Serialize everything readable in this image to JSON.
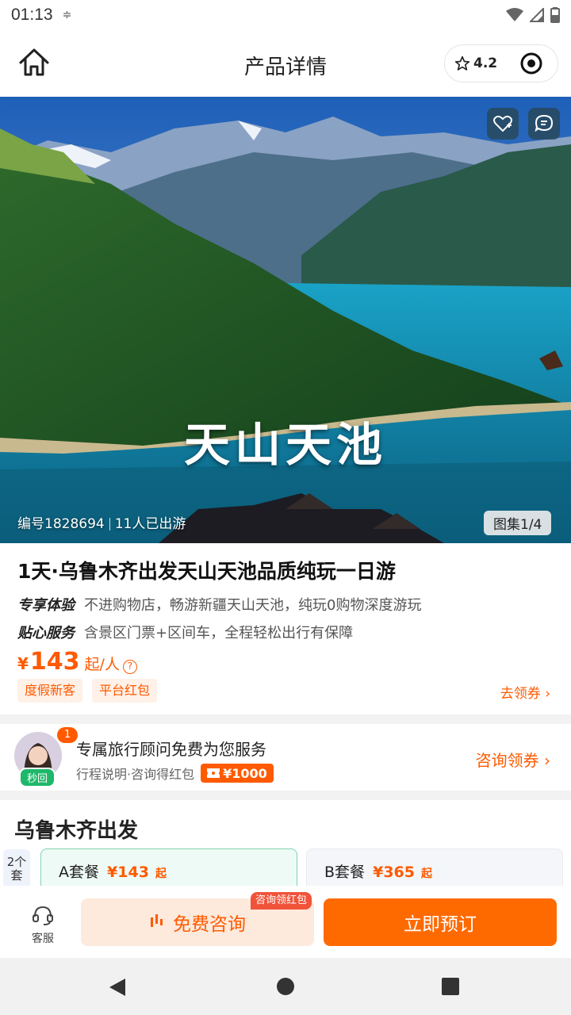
{
  "status_bar": {
    "time": "01:13"
  },
  "header": {
    "title": "产品详情",
    "rating": "4.2"
  },
  "hero": {
    "overlay_title": "天山天池",
    "code": "编号1828694",
    "visited": "11人已出游",
    "gallery": "图集1/4"
  },
  "product": {
    "title": "1天·乌鲁木齐出发天山天池品质纯玩一日游",
    "features": [
      {
        "tag": "专享体验",
        "desc": "不进购物店，畅游新疆天山天池，纯玩0购物深度游玩"
      },
      {
        "tag": "贴心服务",
        "desc": "含景区门票+区间车，全程轻松出行有保障"
      }
    ],
    "price": {
      "currency": "¥",
      "amount": "143",
      "unit": "起/人",
      "help": "?"
    },
    "tags": [
      "度假新客",
      "平台红包"
    ],
    "coupon_link": "去领券 ›"
  },
  "advisor": {
    "badge": "1",
    "quick": "秒回",
    "title": "专属旅行顾问免费为您服务",
    "subtitle": "行程说明·咨询得红包",
    "redpack": "¥1000",
    "link": "咨询领券 ›"
  },
  "departure": {
    "title": "乌鲁木齐出发",
    "days_chip": "2个套",
    "packages": [
      {
        "name": "A套餐",
        "price": "¥143",
        "suffix": "起"
      },
      {
        "name": "B套餐",
        "price": "¥365",
        "suffix": "起"
      }
    ]
  },
  "bottom_bar": {
    "service": "客服",
    "consult": "免费咨询",
    "consult_badge": "咨询领红包",
    "book": "立即预订"
  },
  "colors": {
    "accent": "#ff5a00",
    "book": "#ff6a00",
    "consult_bg": "#fdeadc"
  }
}
